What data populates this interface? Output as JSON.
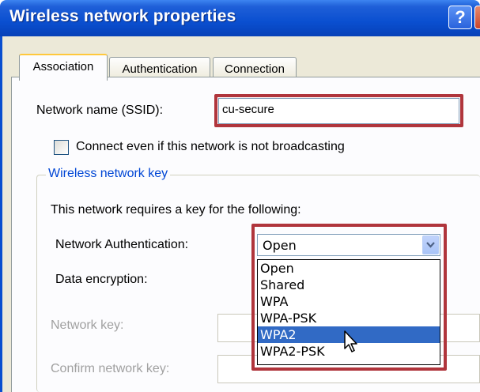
{
  "window": {
    "title": "Wireless network properties",
    "help_glyph": "?",
    "colors": {
      "titlebar": "#0a4fd0",
      "close": "#c9442a",
      "highlight": "#b0353c",
      "selection": "#316ac5"
    }
  },
  "tabs": [
    {
      "label": "Association",
      "active": true
    },
    {
      "label": "Authentication",
      "active": false
    },
    {
      "label": "Connection",
      "active": false
    }
  ],
  "ssid": {
    "label": "Network name (SSID):",
    "value": "cu-secure"
  },
  "broadcast_checkbox": {
    "label": "Connect even if this network is not broadcasting",
    "checked": false
  },
  "key_group": {
    "legend": "Wireless network key",
    "description": "This network requires a key for the following:",
    "auth_label": "Network Authentication:",
    "auth_value": "Open",
    "encryption_label": "Data encryption:",
    "key_label": "Network key:",
    "confirm_label": "Confirm network key:",
    "auth_options": [
      "Open",
      "Shared",
      "WPA",
      "WPA-PSK",
      "WPA2",
      "WPA2-PSK"
    ],
    "highlighted_option": "WPA2"
  }
}
